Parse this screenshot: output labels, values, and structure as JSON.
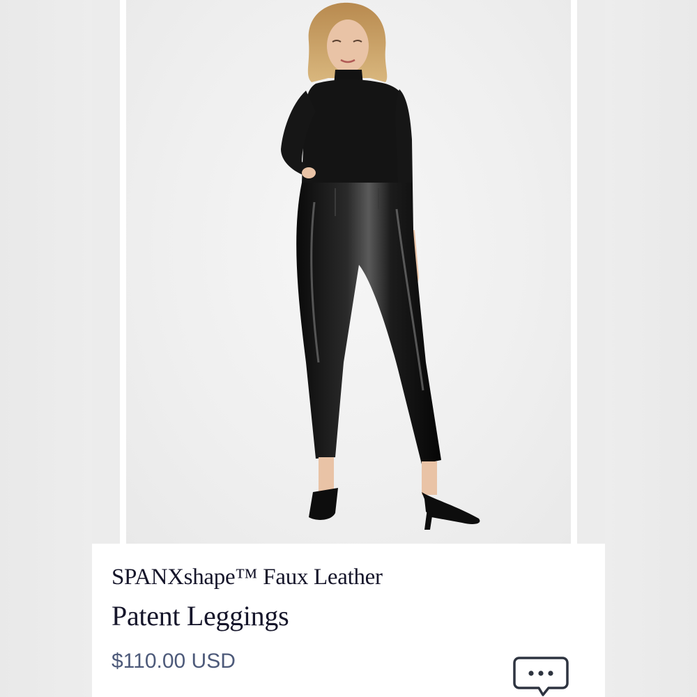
{
  "product": {
    "name_line1": "SPANXshape™ Faux Leather",
    "name_line2": "Patent Leggings",
    "price": "$110.00 USD"
  },
  "gallery": {
    "image_alt": "Model wearing black turtleneck and black patent faux leather leggings with pointed kitten-heel mules"
  },
  "icons": {
    "chat": "chat-bubble-icon"
  },
  "colors": {
    "title": "#15152a",
    "price": "#4d5a7a",
    "background": "#ececec"
  }
}
